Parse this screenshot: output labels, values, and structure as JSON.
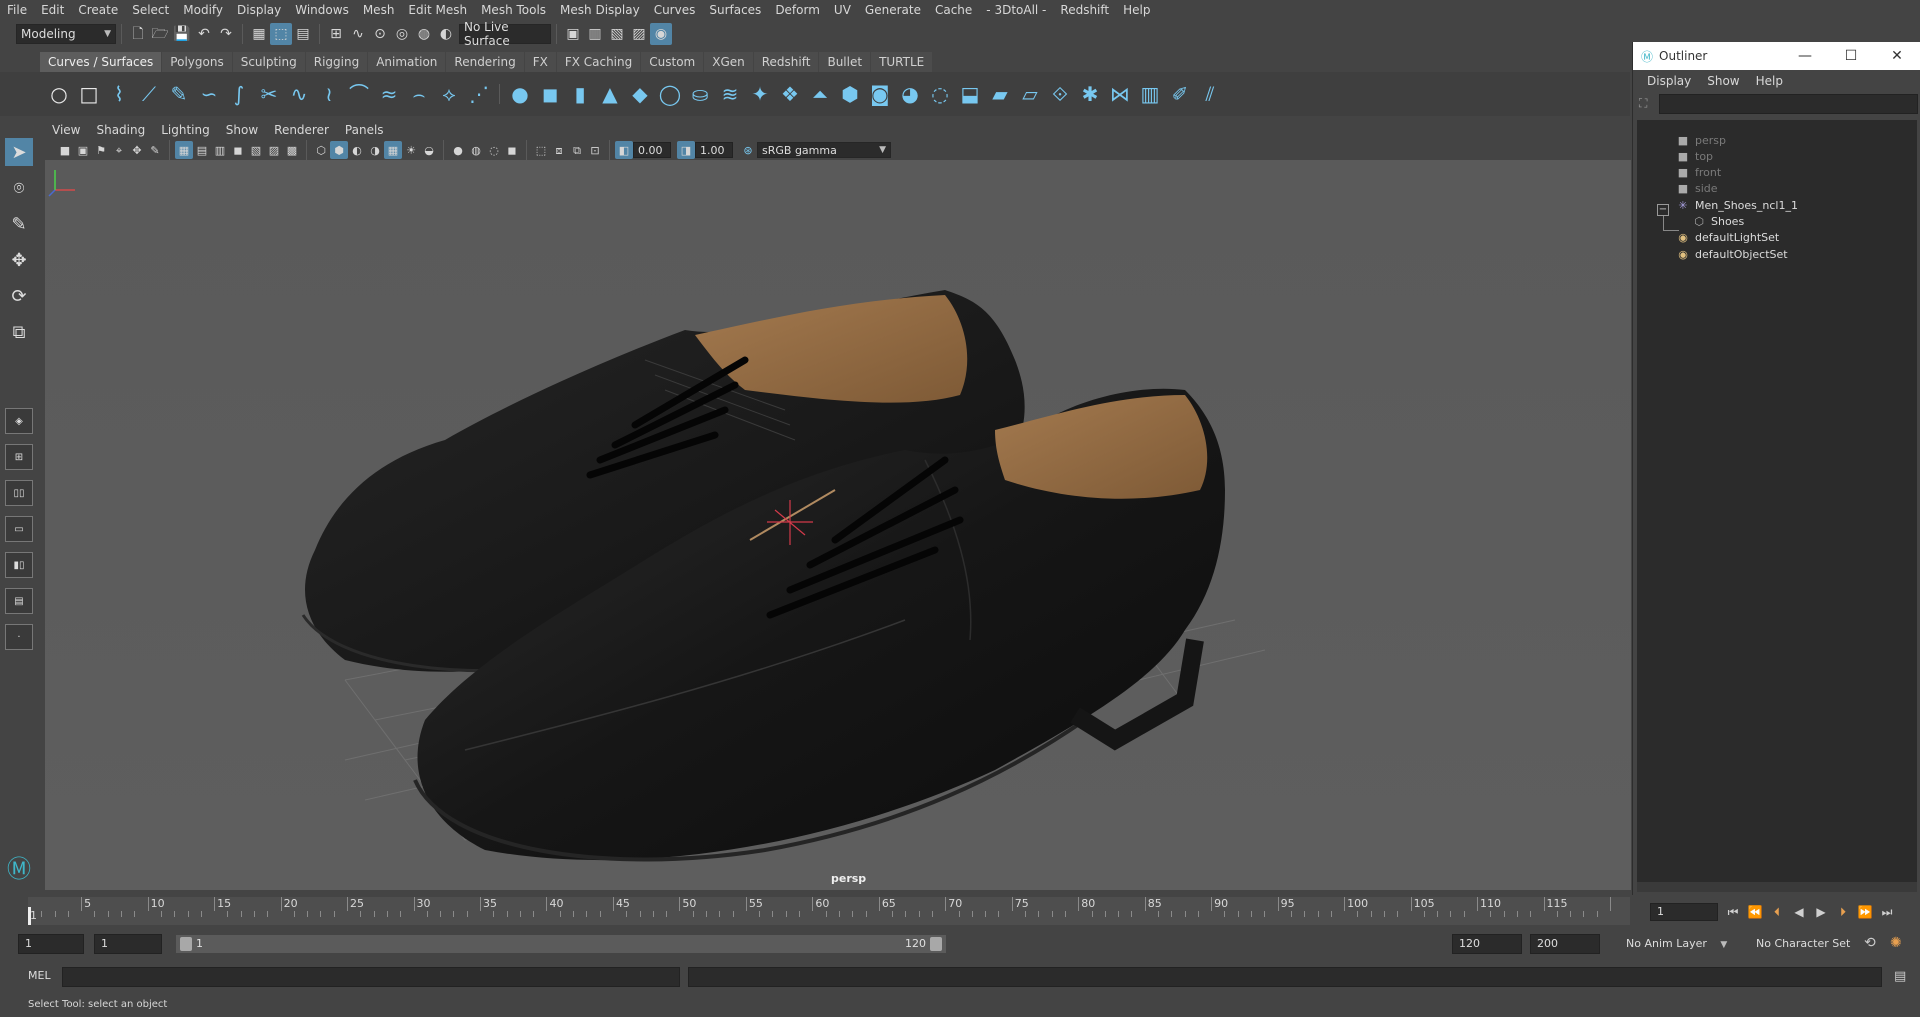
{
  "menubar": [
    "File",
    "Edit",
    "Create",
    "Select",
    "Modify",
    "Display",
    "Windows",
    "Mesh",
    "Edit Mesh",
    "Mesh Tools",
    "Mesh Display",
    "Curves",
    "Surfaces",
    "Deform",
    "UV",
    "Generate",
    "Cache",
    "- 3DtoAll -",
    "Redshift",
    "Help"
  ],
  "statusline": {
    "mode": "Modeling",
    "live_surface": "No Live Surface"
  },
  "shelf": {
    "tabs": [
      "Curves / Surfaces",
      "Polygons",
      "Sculpting",
      "Rigging",
      "Animation",
      "Rendering",
      "FX",
      "FX Caching",
      "Custom",
      "XGen",
      "Redshift",
      "Bullet",
      "TURTLE"
    ],
    "active_tab": "Curves / Surfaces"
  },
  "viewport": {
    "menu": [
      "View",
      "Shading",
      "Lighting",
      "Show",
      "Renderer",
      "Panels"
    ],
    "exposure": "0.00",
    "gamma": "1.00",
    "color_space": "sRGB gamma",
    "camera": "persp"
  },
  "outliner": {
    "title": "Outliner",
    "menu": [
      "Display",
      "Show",
      "Help"
    ],
    "items": [
      {
        "label": "persp",
        "icon": "camera-icon",
        "dim": true
      },
      {
        "label": "top",
        "icon": "camera-icon",
        "dim": true
      },
      {
        "label": "front",
        "icon": "camera-icon",
        "dim": true
      },
      {
        "label": "side",
        "icon": "camera-icon",
        "dim": true
      },
      {
        "label": "Men_Shoes_ncl1_1",
        "icon": "group-icon",
        "dim": false
      },
      {
        "label": "Shoes",
        "icon": "mesh-icon",
        "dim": false
      },
      {
        "label": "defaultLightSet",
        "icon": "set-icon",
        "dim": false
      },
      {
        "label": "defaultObjectSet",
        "icon": "set-icon",
        "dim": false
      }
    ]
  },
  "timeline": {
    "first_label": "1",
    "ticks": [
      "5",
      "10",
      "15",
      "20",
      "25",
      "30",
      "35",
      "40",
      "45",
      "50",
      "55",
      "60",
      "65",
      "70",
      "75",
      "80",
      "85",
      "90",
      "95",
      "100",
      "105",
      "110",
      "115"
    ],
    "current_frame": "1"
  },
  "range": {
    "start": "1",
    "playback_start": "1",
    "range_start_label": "1",
    "range_end_label": "120",
    "playback_end": "120",
    "end": "200",
    "anim_layer": "No Anim Layer",
    "character_set": "No Character Set"
  },
  "cmdline": {
    "label": "MEL"
  },
  "helpline": {
    "text": "Select Tool: select an object"
  }
}
